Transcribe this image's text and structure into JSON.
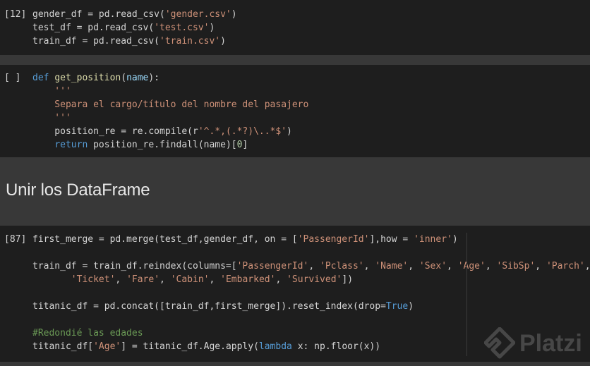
{
  "cells": [
    {
      "prompt": "[12]",
      "lines": [
        [
          {
            "t": "gender_df = pd.read_csv(",
            "c": ""
          },
          {
            "t": "'gender.csv'",
            "c": "str"
          },
          {
            "t": ")",
            "c": ""
          }
        ],
        [
          {
            "t": "test_df = pd.read_csv(",
            "c": ""
          },
          {
            "t": "'test.csv'",
            "c": "str"
          },
          {
            "t": ")",
            "c": ""
          }
        ],
        [
          {
            "t": "train_df = pd.read_csv(",
            "c": ""
          },
          {
            "t": "'train.csv'",
            "c": "str"
          },
          {
            "t": ")",
            "c": ""
          }
        ]
      ]
    },
    {
      "prompt": "[ ]",
      "lines": [
        [
          {
            "t": "def ",
            "c": "kw"
          },
          {
            "t": "get_position",
            "c": "fn"
          },
          {
            "t": "(",
            "c": ""
          },
          {
            "t": "name",
            "c": "param"
          },
          {
            "t": "):",
            "c": ""
          }
        ],
        [
          {
            "t": "    '''",
            "c": "str"
          }
        ],
        [
          {
            "t": "    Separa el cargo/título del nombre del pasajero",
            "c": "str"
          }
        ],
        [
          {
            "t": "    '''",
            "c": "str"
          }
        ],
        [
          {
            "t": "    position_re = re.compile(r",
            "c": ""
          },
          {
            "t": "'^.*,(.*?)\\..*$'",
            "c": "str"
          },
          {
            "t": ")",
            "c": ""
          }
        ],
        [
          {
            "t": "    ",
            "c": ""
          },
          {
            "t": "return",
            "c": "kw"
          },
          {
            "t": " position_re.findall(name)[",
            "c": ""
          },
          {
            "t": "0",
            "c": "num"
          },
          {
            "t": "]",
            "c": ""
          }
        ]
      ]
    },
    {
      "prompt": "[87]",
      "lines": [
        [
          {
            "t": "first_merge = pd.merge(test_df,gender_df, on = [",
            "c": ""
          },
          {
            "t": "'PassengerId'",
            "c": "str"
          },
          {
            "t": "],how = ",
            "c": ""
          },
          {
            "t": "'inner'",
            "c": "str"
          },
          {
            "t": ")",
            "c": ""
          }
        ],
        [],
        [
          {
            "t": "train_df = train_df.reindex(columns=[",
            "c": ""
          },
          {
            "t": "'PassengerId'",
            "c": "str"
          },
          {
            "t": ", ",
            "c": ""
          },
          {
            "t": "'Pclass'",
            "c": "str"
          },
          {
            "t": ", ",
            "c": ""
          },
          {
            "t": "'Name'",
            "c": "str"
          },
          {
            "t": ", ",
            "c": ""
          },
          {
            "t": "'Sex'",
            "c": "str"
          },
          {
            "t": ", ",
            "c": ""
          },
          {
            "t": "'Age'",
            "c": "str"
          },
          {
            "t": ", ",
            "c": ""
          },
          {
            "t": "'SibSp'",
            "c": "str"
          },
          {
            "t": ", ",
            "c": ""
          },
          {
            "t": "'Parch'",
            "c": "str"
          },
          {
            "t": ",",
            "c": ""
          }
        ],
        [
          {
            "t": "       ",
            "c": ""
          },
          {
            "t": "'Ticket'",
            "c": "str"
          },
          {
            "t": ", ",
            "c": ""
          },
          {
            "t": "'Fare'",
            "c": "str"
          },
          {
            "t": ", ",
            "c": ""
          },
          {
            "t": "'Cabin'",
            "c": "str"
          },
          {
            "t": ", ",
            "c": ""
          },
          {
            "t": "'Embarked'",
            "c": "str"
          },
          {
            "t": ", ",
            "c": ""
          },
          {
            "t": "'Survived'",
            "c": "str"
          },
          {
            "t": "])",
            "c": ""
          }
        ],
        [],
        [
          {
            "t": "titanic_df = pd.concat([train_df,first_merge]).reset_index(drop=",
            "c": ""
          },
          {
            "t": "True",
            "c": "kw"
          },
          {
            "t": ")",
            "c": ""
          }
        ],
        [],
        [
          {
            "t": "#Redondié las edades",
            "c": "com"
          }
        ],
        [
          {
            "t": "titanic_df[",
            "c": ""
          },
          {
            "t": "'Age'",
            "c": "str"
          },
          {
            "t": "] = titanic_df.Age.apply(",
            "c": ""
          },
          {
            "t": "lambda",
            "c": "kw"
          },
          {
            "t": " x: np.floor(x))",
            "c": ""
          }
        ]
      ]
    }
  ],
  "markdown": {
    "heading": "Unir los DataFrame"
  },
  "watermark": {
    "text": "Platzi"
  }
}
